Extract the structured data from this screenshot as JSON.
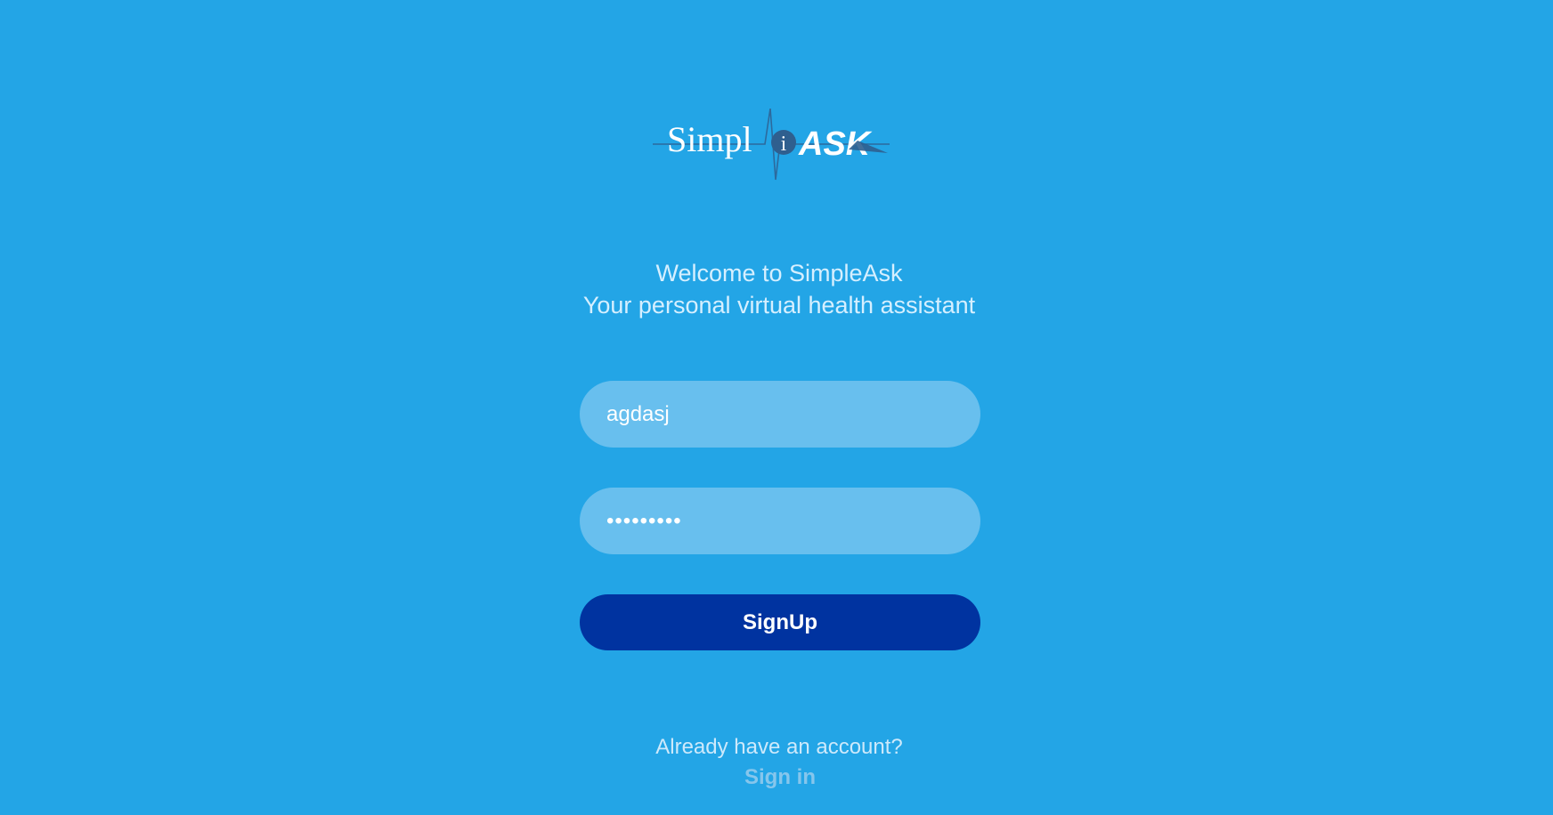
{
  "brand": {
    "logo_text_left": "Simpl",
    "logo_text_mid": "i",
    "logo_text_right": "ASK"
  },
  "welcome": {
    "line1": "Welcome to SimpleAsk",
    "line2": "Your personal virtual health assistant"
  },
  "form": {
    "username_value": "agdasj",
    "password_value": "•••••••••",
    "signup_label": "SignUp"
  },
  "footer": {
    "prompt": "Already have an account?",
    "signin_label": "Sign in"
  },
  "colors": {
    "background": "#23a5e6",
    "field_background": "#68bfee",
    "button_background": "#0033a0",
    "logo_dark": "#2f5f8f"
  },
  "icons": {
    "logo": "heartbeat-logo-icon"
  }
}
